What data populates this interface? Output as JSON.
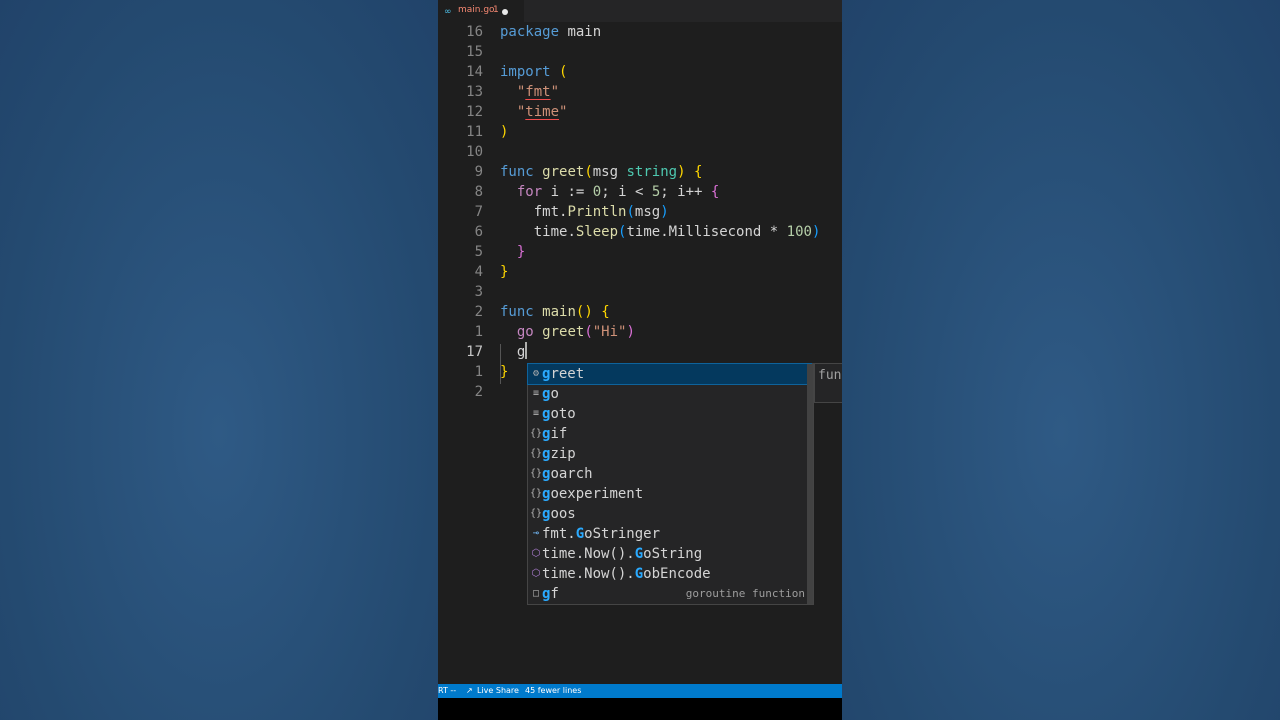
{
  "tab": {
    "icon": "go-file-icon",
    "icon_glyph": "∞",
    "filename": "main.go",
    "problem_count": "1",
    "modified": true
  },
  "editor": {
    "lines": [
      {
        "num": "16",
        "code": "package main"
      },
      {
        "num": "15",
        "code": ""
      },
      {
        "num": "14",
        "code": "import ("
      },
      {
        "num": "13",
        "code": "  \"fmt\""
      },
      {
        "num": "12",
        "code": "  \"time\""
      },
      {
        "num": "11",
        "code": ")"
      },
      {
        "num": "10",
        "code": ""
      },
      {
        "num": "9",
        "code": "func greet(msg string) {"
      },
      {
        "num": "8",
        "code": "  for i := 0; i < 5; i++ {"
      },
      {
        "num": "7",
        "code": "    fmt.Println(msg)"
      },
      {
        "num": "6",
        "code": "    time.Sleep(time.Millisecond * 100)"
      },
      {
        "num": "5",
        "code": "  }"
      },
      {
        "num": "4",
        "code": "}"
      },
      {
        "num": "3",
        "code": ""
      },
      {
        "num": "2",
        "code": "func main() {"
      },
      {
        "num": "1",
        "code": "  go greet(\"Hi\")"
      },
      {
        "num": "17",
        "code": "  g"
      },
      {
        "num": "1",
        "code": "}"
      },
      {
        "num": "2",
        "code": ""
      }
    ]
  },
  "suggestions": [
    {
      "icon": "method-icon",
      "glyph": "⚙",
      "prefix": "",
      "match": "g",
      "rest": "reet",
      "detail": ""
    },
    {
      "icon": "keyword-icon",
      "glyph": "≡",
      "prefix": "",
      "match": "g",
      "rest": "o",
      "detail": ""
    },
    {
      "icon": "keyword-icon",
      "glyph": "≡",
      "prefix": "",
      "match": "g",
      "rest": "oto",
      "detail": ""
    },
    {
      "icon": "module-icon",
      "glyph": "{}",
      "prefix": "",
      "match": "g",
      "rest": "if",
      "detail": ""
    },
    {
      "icon": "module-icon",
      "glyph": "{}",
      "prefix": "",
      "match": "g",
      "rest": "zip",
      "detail": ""
    },
    {
      "icon": "module-icon",
      "glyph": "{}",
      "prefix": "",
      "match": "g",
      "rest": "oarch",
      "detail": ""
    },
    {
      "icon": "module-icon",
      "glyph": "{}",
      "prefix": "",
      "match": "g",
      "rest": "oexperiment",
      "detail": ""
    },
    {
      "icon": "module-icon",
      "glyph": "{}",
      "prefix": "",
      "match": "g",
      "rest": "oos",
      "detail": ""
    },
    {
      "icon": "interface-icon",
      "glyph": "⊸",
      "prefix": "fmt.",
      "match": "G",
      "rest": "oStringer",
      "detail": ""
    },
    {
      "icon": "method-icon",
      "glyph": "⬡",
      "prefix": "time.Now().",
      "match": "G",
      "rest": "oString",
      "detail": ""
    },
    {
      "icon": "method-icon",
      "glyph": "⬡",
      "prefix": "time.Now().",
      "match": "G",
      "rest": "obEncode",
      "detail": ""
    },
    {
      "icon": "snippet-icon",
      "glyph": "□",
      "prefix": "",
      "match": "g",
      "rest": "f",
      "detail": "goroutine function"
    }
  ],
  "details_pane": {
    "text": "fun"
  },
  "statusbar": {
    "left": "RT --",
    "live_share_icon": "↗",
    "live_share": "Live Share",
    "info": "45 fewer lines"
  },
  "colors": {
    "background": "#2a4d72",
    "editor": "#1e1e1e",
    "statusbar": "#007acc",
    "selection": "#04395e",
    "match_highlight": "#2aaaff"
  }
}
